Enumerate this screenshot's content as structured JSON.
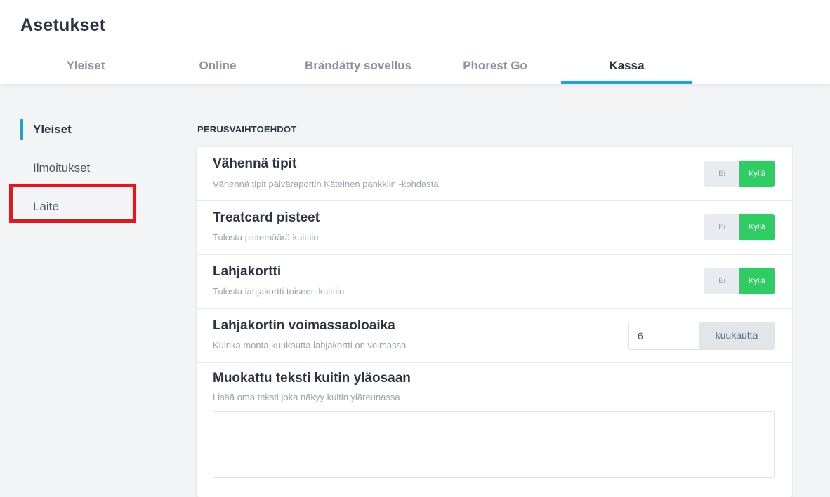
{
  "header": {
    "title": "Asetukset",
    "tabs": [
      {
        "label": "Yleiset"
      },
      {
        "label": "Online"
      },
      {
        "label": "Brändätty sovellus"
      },
      {
        "label": "Phorest Go"
      },
      {
        "label": "Kassa",
        "active": true
      }
    ]
  },
  "sidebar": {
    "items": [
      {
        "label": "Yleiset",
        "active": true
      },
      {
        "label": "Ilmoitukset"
      },
      {
        "label": "Laite",
        "highlighted": true
      }
    ]
  },
  "main": {
    "section_title": "PERUSVAIHTOEHDOT",
    "rows": [
      {
        "title": "Vähennä tipit",
        "description": "Vähennä tipit päiväraportin Käteinen pankkiin -kohdasta",
        "toggle": {
          "no": "Ei",
          "yes": "Kyllä",
          "value": "Kyllä"
        }
      },
      {
        "title": "Treatcard pisteet",
        "description": "Tulosta pistemäärä kuittiin",
        "toggle": {
          "no": "Ei",
          "yes": "Kyllä",
          "value": "Kyllä"
        }
      },
      {
        "title": "Lahjakortti",
        "description": "Tulosta lahjakortti toiseen kuittiin",
        "toggle": {
          "no": "Ei",
          "yes": "Kyllä",
          "value": "Kyllä"
        }
      },
      {
        "title": "Lahjakortin voimassaoloaika",
        "description": "Kuinka monta kuukautta lahjakortti on voimassa",
        "input_value": "6",
        "unit": "kuukautta"
      },
      {
        "title": "Muokattu teksti kuitin yläosaan",
        "description": "Lisää oma teksti joka näkyy kuitin yläreunassa",
        "text_value": ""
      }
    ]
  },
  "colors": {
    "accent": "#1fa2d6",
    "toggle_on": "#2ecc63",
    "highlight": "#e0181f"
  }
}
